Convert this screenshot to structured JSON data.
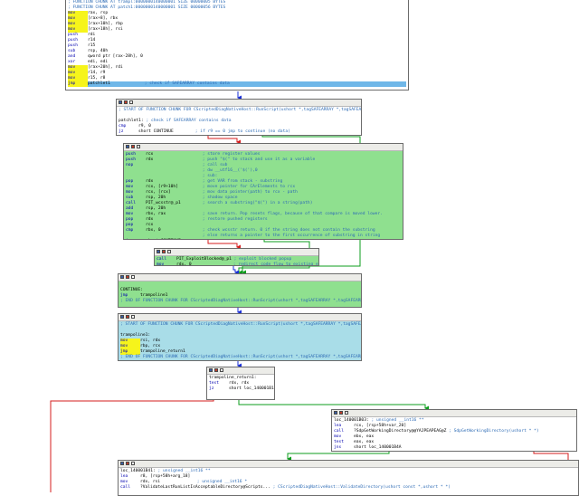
{
  "top_block": {
    "lines": [
      {
        "label": "; FUNCTION CHUNK AT trampl:0000000140000001 SIZE 00000005 BYTES"
      },
      {
        "label": "; FUNCTION CHUNK AT patch1:0000000140000001 SIZE 00000056 BYTES"
      },
      {
        "mn": "mov",
        "op": "rax, rsp"
      },
      {
        "mn": "mov",
        "op": "[rax+8], rbx"
      },
      {
        "mn": "mov",
        "op": "[rax+10h], rbp"
      },
      {
        "mn": "mov",
        "op": "[rax+18h], rsi"
      },
      {
        "mn": "push",
        "op": "rdi"
      },
      {
        "mn": "push",
        "op": "r14"
      },
      {
        "mn": "push",
        "op": "r15"
      },
      {
        "mn": "sub",
        "op": "rsp, 40h"
      },
      {
        "mn": "and",
        "op": "qword ptr [rax-28h], 0"
      },
      {
        "mn": "xor",
        "op": "edi, edi"
      },
      {
        "mn": "mov",
        "op": "[rax+20h], rdi"
      },
      {
        "mn": "mov",
        "op": "r14, r9"
      },
      {
        "mn": "mov",
        "op": "r15, r8"
      },
      {
        "mn": "jmp",
        "op": "patchlet1",
        "cm": "; check if SAFEARRAY contains data"
      }
    ]
  },
  "patchlet_block": {
    "lines": [
      {
        "label": "; START OF FUNCTION CHUNK FOR CScriptedDiagNativeHost::RunScript(ushort *,tagSAFEARRAY *,tagSAFEARRAY *)"
      },
      {
        "label": ""
      },
      {
        "label": "patchlet1:",
        "cm": "; check if SAFEARRAY contains data"
      },
      {
        "mn": "cmp",
        "op": "r9, 0"
      },
      {
        "mn": "jz",
        "op": "short CONTINUE",
        "cm": "; if r9 == 0 jmp to continue (no data)"
      }
    ]
  },
  "green_block": {
    "lines": [
      {
        "mn": "push",
        "op": "rcx",
        "cm": "; store register values"
      },
      {
        "mn": "push",
        "op": "rdx",
        "cm": "; push \"$(\" to stack and use it as a variable"
      },
      {
        "mn": "nop",
        "op": "",
        "cm": "; call sub"
      },
      {
        "mn": "",
        "op": "",
        "cm": "; dw __utf16__('$('),0"
      },
      {
        "mn": "",
        "op": "",
        "cm": "; sub:"
      },
      {
        "mn": "pop",
        "op": "rdx",
        "cm": "; get VAR from stack - substring"
      },
      {
        "mn": "mov",
        "op": "rcx, [r9+10h]",
        "cm": "; move pointer for CArElements to rcx"
      },
      {
        "mn": "mov",
        "op": "rcx, [rcx]",
        "cm": "; mov data pointer(path) to rcx - path"
      },
      {
        "mn": "sub",
        "op": "rsp, 20h",
        "cm": "; shadow space"
      },
      {
        "mn": "call",
        "op": "PIT_wcsstr@_p1",
        "cm": "; search a substring(\"$(\") in a string(path)"
      },
      {
        "mn": "add",
        "op": "rsp, 20h",
        "cm": ""
      },
      {
        "mn": "mov",
        "op": "rbx, rax",
        "cm": "; save return. Pop resets flags, because of that compare is moved lower."
      },
      {
        "mn": "pop",
        "op": "rdx",
        "cm": "; restore pushed registers"
      },
      {
        "mn": "pop",
        "op": "rcx",
        "cm": ""
      },
      {
        "mn": "cmp",
        "op": "rbx, 0",
        "cm": "; check wcsstr return. 0 if the string does not contain the substring"
      },
      {
        "mn": "",
        "op": "",
        "cm": "; else returns a pointer to the first occurrence of substring in string"
      },
      {
        "mn": "jz",
        "op": "short CONTINUE",
        "cm": ""
      }
    ]
  },
  "exploit_block": {
    "lines": [
      {
        "mn": "call",
        "op": "PIT_ExploitBlocked@_p1",
        "cm": "; exploit blocked popup"
      },
      {
        "mn": "mov",
        "op": "rdx, 0",
        "cm": "; redirect code flow to existing error block"
      }
    ]
  },
  "continue_block": {
    "lines": [
      {
        "label": ""
      },
      {
        "label": "CONTINUE:"
      },
      {
        "mn": "jmp",
        "op": "trampoline1"
      },
      {
        "label": "; END OF FUNCTION CHUNK FOR CScriptedDiagNativeHost::RunScript(ushort *,tagSAFEARRAY *,tagSAFEARRAY *)"
      }
    ]
  },
  "trampoline_block": {
    "lines": [
      {
        "label": "; START OF FUNCTION CHUNK FOR CScriptedDiagNativeHost::RunScript(ushort *,tagSAFEARRAY *,tagSAFEARRAY *)"
      },
      {
        "label": ""
      },
      {
        "label": "trampoline1:"
      },
      {
        "mn": "mov",
        "op": "rsi, rdx"
      },
      {
        "mn": "mov",
        "op": "rbp, rcx"
      },
      {
        "mn": "jmp",
        "op": "trampoline_return1"
      },
      {
        "label": "; END OF FUNCTION CHUNK FOR CScriptedDiagNativeHost::RunScript(ushort *,tagSAFEARRAY *,tagSAFEARRAY *)"
      }
    ]
  },
  "return_block": {
    "lines": [
      {
        "label": "trampoline_return1:"
      },
      {
        "mn": "test",
        "op": "rdx, rdx"
      },
      {
        "mn": "jz",
        "op": "short loc_140001B13"
      }
    ]
  },
  "loc_b03_block": {
    "lines": [
      {
        "label": "loc_140001B03:",
        "cm": "; unsigned __int16 **"
      },
      {
        "mn": "lea",
        "op": "rcx, [rsp+58h+var_20]"
      },
      {
        "mn": "call",
        "op": "?SdpGetWorkingDirectory@@YAJPEAPEAG@Z",
        "cm": "; SdpGetWorkingDirectory(ushort * *)"
      },
      {
        "mn": "mov",
        "op": "ebx, eax"
      },
      {
        "mn": "test",
        "op": "eax, eax"
      },
      {
        "mn": "jns",
        "op": "short loc_140001B4A"
      }
    ]
  },
  "loc_b41_block": {
    "lines": [
      {
        "label": "loc_140001B41:",
        "cm": "; unsigned __int16 **"
      },
      {
        "mn": "lea",
        "op": "r8, [rsp+58h+arg_18]"
      },
      {
        "mn": "mov",
        "op": "rdx, rsi",
        "cm": "; unsigned __int16 *"
      },
      {
        "mn": "call",
        "op": "?ValidateLastRunListIsAcceptableDirectory@Scripts...",
        "cm": "; CScriptedDiagNativeHost::ValidateDirectory(ushort const *,ushort * *)"
      }
    ]
  }
}
